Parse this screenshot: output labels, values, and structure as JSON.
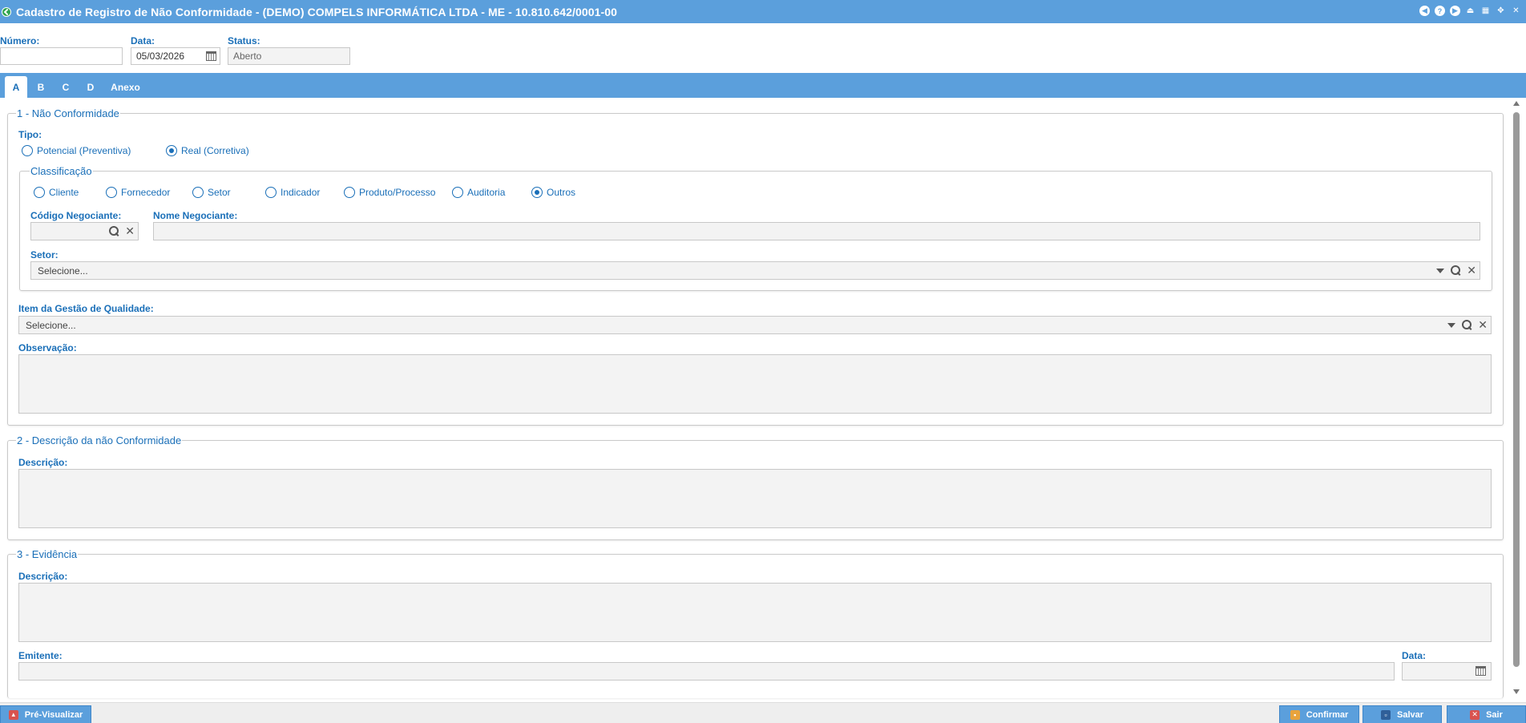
{
  "window": {
    "title": "Cadastro de Registro de Não Conformidade - (DEMO) COMPELS INFORMÁTICA LTDA - ME - 10.810.642/0001-00",
    "icons": [
      "back-icon",
      "help-icon",
      "forward-icon",
      "upload-icon",
      "calendar-icon",
      "restore-icon",
      "close-icon"
    ]
  },
  "header": {
    "numero_label": "Número:",
    "numero_value": "",
    "data_label": "Data:",
    "data_value": "05/03/2026",
    "status_label": "Status:",
    "status_value": "Aberto"
  },
  "tabs": [
    {
      "label": "A",
      "active": true
    },
    {
      "label": "B",
      "active": false
    },
    {
      "label": "C",
      "active": false
    },
    {
      "label": "D",
      "active": false
    },
    {
      "label": "Anexo",
      "active": false
    }
  ],
  "section1": {
    "legend": "1 - Não Conformidade",
    "tipo_label": "Tipo:",
    "tipo_options": [
      {
        "label": "Potencial (Preventiva)",
        "checked": false
      },
      {
        "label": "Real (Corretiva)",
        "checked": true
      }
    ],
    "classificacao": {
      "legend": "Classificação",
      "options": [
        {
          "label": "Cliente",
          "checked": false
        },
        {
          "label": "Fornecedor",
          "checked": false
        },
        {
          "label": "Setor",
          "checked": false
        },
        {
          "label": "Indicador",
          "checked": false
        },
        {
          "label": "Produto/Processo",
          "checked": false
        },
        {
          "label": "Auditoria",
          "checked": false
        },
        {
          "label": "Outros",
          "checked": true
        }
      ],
      "codigo_label": "Código Negociante:",
      "codigo_value": "",
      "nome_label": "Nome Negociante:",
      "nome_value": "",
      "setor_label": "Setor:",
      "setor_value": "Selecione..."
    },
    "item_label": "Item da Gestão de Qualidade:",
    "item_value": "Selecione...",
    "obs_label": "Observação:",
    "obs_value": ""
  },
  "section2": {
    "legend": "2 - Descrição da não Conformidade",
    "desc_label": "Descrição:",
    "desc_value": ""
  },
  "section3": {
    "legend": "3 - Evidência",
    "desc_label": "Descrição:",
    "desc_value": "",
    "emitente_label": "Emitente:",
    "emitente_value": "",
    "data_label": "Data:",
    "data_value": ""
  },
  "footer": {
    "preview_label": "Pré-Visualizar",
    "confirm_label": "Confirmar",
    "save_label": "Salvar",
    "exit_label": "Sair"
  },
  "colors": {
    "accent": "#5b9fdc",
    "label": "#1a6fb8",
    "exit": "#d9534f",
    "pdf": "#d9534f",
    "confirm": "#e8a33c"
  }
}
